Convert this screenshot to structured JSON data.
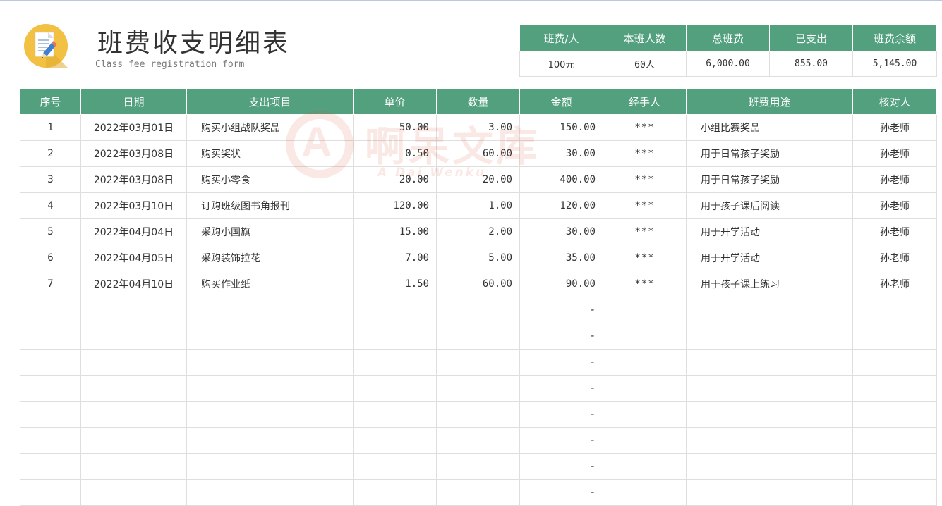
{
  "header": {
    "title": "班费收支明细表",
    "subtitle": "Class fee registration form",
    "logo_icon": "document-pencil-icon"
  },
  "summary": {
    "headers": [
      "班费/人",
      "本班人数",
      "总班费",
      "已支出",
      "班费余额"
    ],
    "values": [
      "100元",
      "60人",
      "6,000.00",
      "855.00",
      "5,145.00"
    ]
  },
  "table": {
    "headers": [
      "序号",
      "日期",
      "支出项目",
      "单价",
      "数量",
      "金额",
      "经手人",
      "班费用途",
      "核对人"
    ],
    "rows": [
      [
        "1",
        "2022年03月01日",
        "购买小组战队奖品",
        "50.00",
        "3.00",
        "150.00",
        "***",
        "小组比赛奖品",
        "孙老师"
      ],
      [
        "2",
        "2022年03月08日",
        "购买奖状",
        "0.50",
        "60.00",
        "30.00",
        "***",
        "用于日常孩子奖励",
        "孙老师"
      ],
      [
        "3",
        "2022年03月08日",
        "购买小零食",
        "20.00",
        "20.00",
        "400.00",
        "***",
        "用于日常孩子奖励",
        "孙老师"
      ],
      [
        "4",
        "2022年03月10日",
        "订购班级图书角报刊",
        "120.00",
        "1.00",
        "120.00",
        "***",
        "用于孩子课后阅读",
        "孙老师"
      ],
      [
        "5",
        "2022年04月04日",
        "采购小国旗",
        "15.00",
        "2.00",
        "30.00",
        "***",
        "用于开学活动",
        "孙老师"
      ],
      [
        "6",
        "2022年04月05日",
        "采购装饰拉花",
        "7.00",
        "5.00",
        "35.00",
        "***",
        "用于开学活动",
        "孙老师"
      ],
      [
        "7",
        "2022年04月10日",
        "购买作业纸",
        "1.50",
        "60.00",
        "90.00",
        "***",
        "用于孩子课上练习",
        "孙老师"
      ],
      [
        "",
        "",
        "",
        "",
        "",
        "-",
        "",
        "",
        ""
      ],
      [
        "",
        "",
        "",
        "",
        "",
        "-",
        "",
        "",
        ""
      ],
      [
        "",
        "",
        "",
        "",
        "",
        "-",
        "",
        "",
        ""
      ],
      [
        "",
        "",
        "",
        "",
        "",
        "-",
        "",
        "",
        ""
      ],
      [
        "",
        "",
        "",
        "",
        "",
        "-",
        "",
        "",
        ""
      ],
      [
        "",
        "",
        "",
        "",
        "",
        "-",
        "",
        "",
        ""
      ],
      [
        "",
        "",
        "",
        "",
        "",
        "-",
        "",
        "",
        ""
      ],
      [
        "",
        "",
        "",
        "",
        "",
        "-",
        "",
        "",
        ""
      ]
    ]
  },
  "watermark": {
    "letter": "A",
    "text": "啊呆文库",
    "sub": "A Dai Wenku"
  },
  "colors": {
    "header_green": "#52a07e",
    "logo_yellow": "#f2c042",
    "watermark_red": "#e0553b"
  }
}
